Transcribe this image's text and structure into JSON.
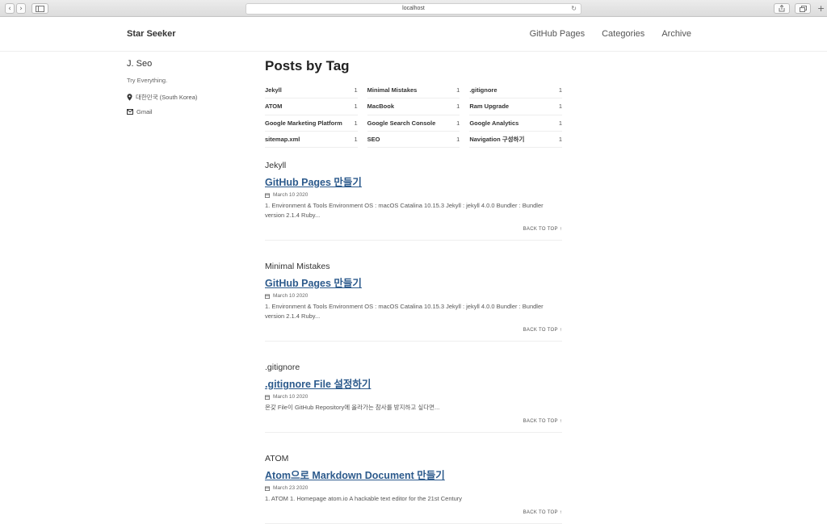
{
  "browser": {
    "url": "localhost",
    "reload_icon": "↻",
    "back_icon": "‹",
    "forward_icon": "›"
  },
  "site": {
    "title": "Star Seeker"
  },
  "nav": [
    "GitHub Pages",
    "Categories",
    "Archive"
  ],
  "author": {
    "name": "J. Seo",
    "bio": "Try Everything.",
    "location": "대한민국 (South Korea)",
    "email": "Gmail",
    "location_icon": "map-marker-icon",
    "email_icon": "envelope-icon"
  },
  "page": {
    "title": "Posts by Tag"
  },
  "tags": [
    {
      "name": "Jekyll",
      "count": "1"
    },
    {
      "name": "Minimal Mistakes",
      "count": "1"
    },
    {
      "name": ".gitignore",
      "count": "1"
    },
    {
      "name": "ATOM",
      "count": "1"
    },
    {
      "name": "MacBook",
      "count": "1"
    },
    {
      "name": "Ram Upgrade",
      "count": "1"
    },
    {
      "name": "Google Marketing Platform",
      "count": "1"
    },
    {
      "name": "Google Search Console",
      "count": "1"
    },
    {
      "name": "Google Analytics",
      "count": "1"
    },
    {
      "name": "sitemap.xml",
      "count": "1"
    },
    {
      "name": "SEO",
      "count": "1"
    },
    {
      "name": "Navigation 구성하기",
      "count": "1"
    }
  ],
  "sections": [
    {
      "tag": "Jekyll",
      "post_title": "GitHub Pages 만들기",
      "date": "March 10 2020",
      "excerpt": "1. Environment & Tools Environment OS : macOS Catalina 10.15.3 Jekyll : jekyll 4.0.0 Bundler : Bundler version 2.1.4 Ruby...",
      "back": "BACK TO TOP ↑"
    },
    {
      "tag": "Minimal Mistakes",
      "post_title": "GitHub Pages 만들기",
      "date": "March 10 2020",
      "excerpt": "1. Environment & Tools Environment OS : macOS Catalina 10.15.3 Jekyll : jekyll 4.0.0 Bundler : Bundler version 2.1.4 Ruby...",
      "back": "BACK TO TOP ↑"
    },
    {
      "tag": ".gitignore",
      "post_title": ".gitignore File 설정하기",
      "date": "March 10 2020",
      "excerpt": "온갖 File이 GitHub Repository에 올라가는 참사를 방지하고 싶다면...",
      "back": "BACK TO TOP ↑"
    },
    {
      "tag": "ATOM",
      "post_title": "Atom으로 Markdown Document 만들기",
      "date": "March 23 2020",
      "excerpt": "1. ATOM 1. Homepage atom.io A hackable text editor for the 21st Century",
      "back": "BACK TO TOP ↑"
    }
  ]
}
